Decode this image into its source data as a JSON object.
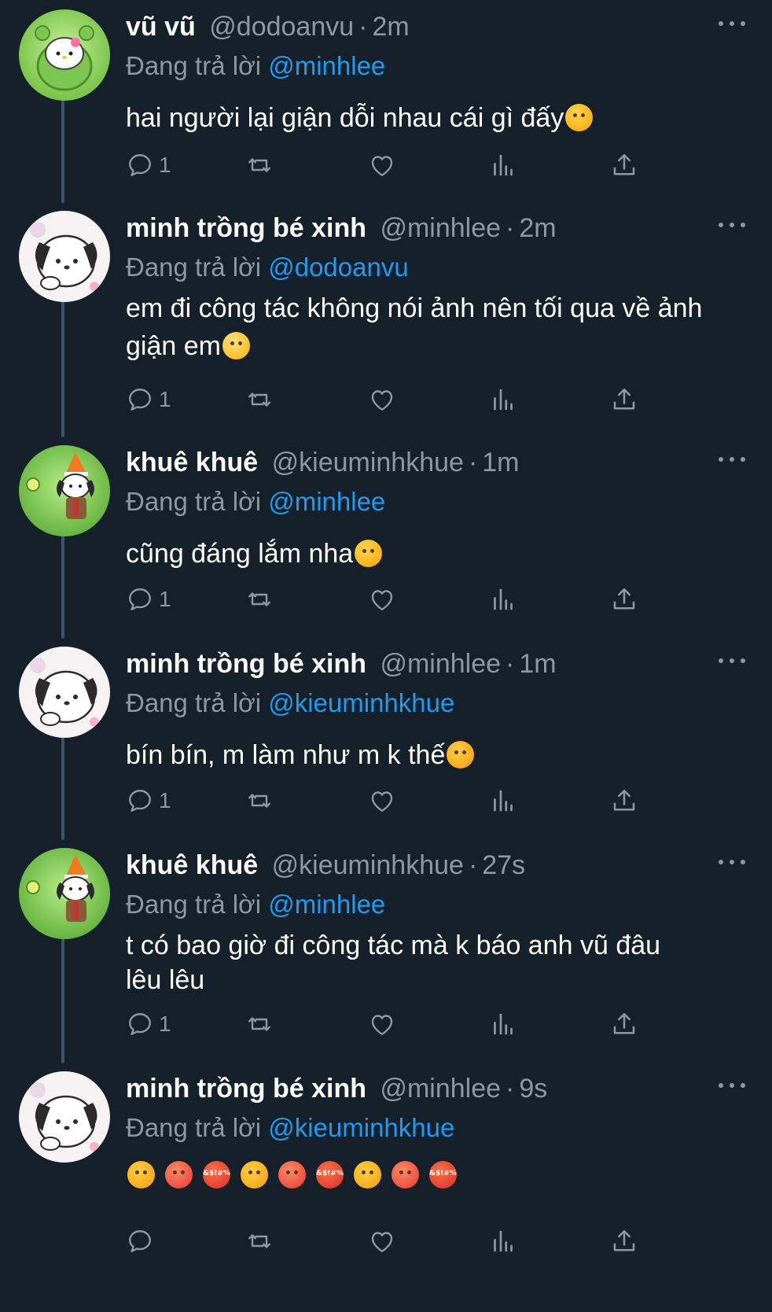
{
  "colors": {
    "background": "#15202b",
    "text_primary": "#ffffff",
    "text_secondary": "#8b98a5",
    "link": "#1d9bf0",
    "thread_line": "#3d5466"
  },
  "tweets": [
    {
      "name": "vũ vũ",
      "handle": "@dodoanvu",
      "dot": "·",
      "time": "2m",
      "reply_prefix": "Đang trả lời",
      "reply_to": "@minhlee",
      "text": "hai người lại giận dỗi nhau cái gì đấy",
      "text_emoji": "smiling-face-emoji",
      "reply_count": "1",
      "avatar": "hello-kitty-avatar"
    },
    {
      "name": "minh trồng bé xinh",
      "handle": "@minhlee",
      "dot": "·",
      "time": "2m",
      "reply_prefix": "Đang trả lời",
      "reply_to": "@dodoanvu",
      "text": "em đi công tác không nói ảnh nên tối qua về ảnh giận em",
      "text_emoji": "pleading-face-emoji",
      "reply_count": "1",
      "avatar": "pochacco-avatar"
    },
    {
      "name": "khuê khuê",
      "handle": "@kieuminhkhue",
      "dot": "·",
      "time": "1m",
      "reply_prefix": "Đang trả lời",
      "reply_to": "@minhlee",
      "text": "cũng đáng lắm nha",
      "text_emoji": "smiling-face-emoji",
      "reply_count": "1",
      "avatar": "pochacco-hat-avatar"
    },
    {
      "name": "minh trồng bé xinh",
      "handle": "@minhlee",
      "dot": "·",
      "time": "1m",
      "reply_prefix": "Đang trả lời",
      "reply_to": "@kieuminhkhue",
      "text": "bín bín, m làm như m k thế",
      "text_emoji": "angry-face-emoji",
      "reply_count": "1",
      "avatar": "pochacco-avatar"
    },
    {
      "name": "khuê khuê",
      "handle": "@kieuminhkhue",
      "dot": "·",
      "time": "27s",
      "reply_prefix": "Đang trả lời",
      "reply_to": "@minhlee",
      "text": "t có bao giờ đi công tác mà k báo anh vũ đâu lêu lêu",
      "text_emoji": "",
      "reply_count": "1",
      "avatar": "pochacco-hat-avatar"
    },
    {
      "name": "minh trồng bé xinh",
      "handle": "@minhlee",
      "dot": "·",
      "time": "9s",
      "reply_prefix": "Đang trả lời",
      "reply_to": "@kieuminhkhue",
      "text": "",
      "emoji_row": [
        "angry-face-emoji",
        "pouting-face-emoji",
        "face-with-symbols-on-mouth-emoji",
        "angry-face-emoji",
        "pouting-face-emoji",
        "face-with-symbols-on-mouth-emoji",
        "angry-face-emoji",
        "pouting-face-emoji",
        "face-with-symbols-on-mouth-emoji"
      ],
      "curse_symbols": "&$!#%",
      "reply_count": "",
      "avatar": "pochacco-avatar"
    }
  ],
  "icons": {
    "reply": "reply-icon",
    "retweet": "retweet-icon",
    "like": "like-icon",
    "views": "views-icon",
    "share": "share-icon",
    "more": "more-options-icon"
  }
}
